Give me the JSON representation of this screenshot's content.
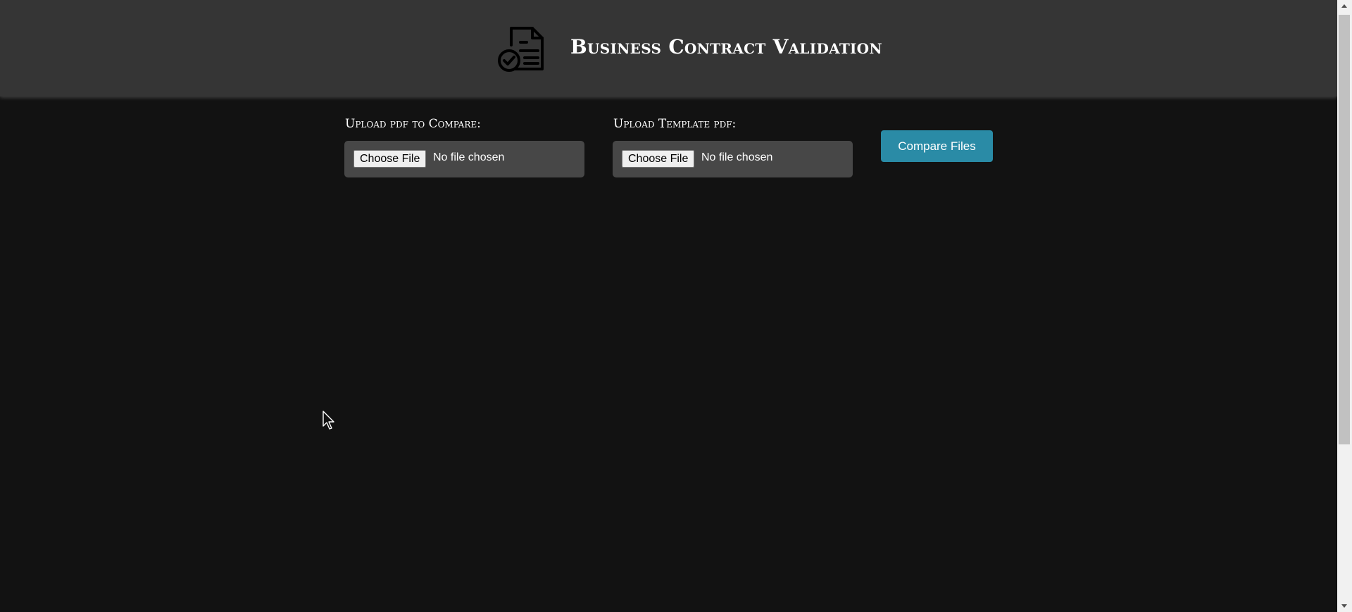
{
  "header": {
    "logo_icon": "document-check-icon",
    "title": "Business Contract Validation"
  },
  "upload_compare": {
    "label": "Upload pdf to Compare:",
    "button_label": "Choose File",
    "status": "No file chosen"
  },
  "upload_template": {
    "label": "Upload Template pdf:",
    "button_label": "Choose File",
    "status": "No file chosen"
  },
  "compare_button": {
    "label": "Compare Files"
  },
  "colors": {
    "page_background": "#121212",
    "header_background": "#353535",
    "file_box_background": "#474747",
    "accent": "#2a8ba6"
  }
}
